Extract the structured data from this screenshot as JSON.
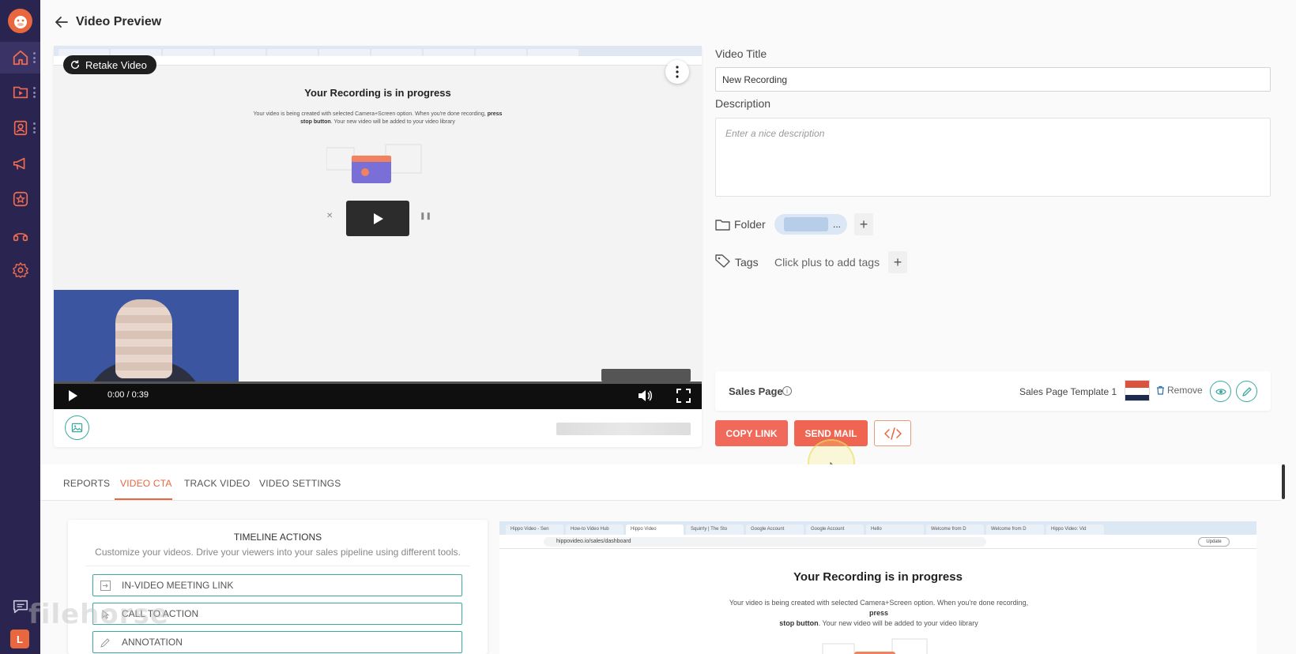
{
  "header": {
    "title": "Video Preview"
  },
  "sidebar": {
    "items": [
      {
        "icon": "home-icon",
        "active": true
      },
      {
        "icon": "video-library-icon"
      },
      {
        "icon": "contacts-icon"
      },
      {
        "icon": "campaign-megaphone-icon"
      },
      {
        "icon": "star-badge-icon"
      },
      {
        "icon": "integrations-icon"
      },
      {
        "icon": "gear-icon"
      }
    ],
    "user_initial": "L"
  },
  "player": {
    "retake_label": "Retake Video",
    "time": "0:00 / 0:39",
    "recording_title": "Your Recording is in progress",
    "recording_text_1": "Your video is being created with selected Camera+Screen option. When you're done recording,",
    "recording_text_bold_1": "press",
    "recording_text_bold_2": "stop button",
    "recording_text_2": ". Your new video will be added to your video library"
  },
  "form": {
    "video_title_label": "Video Title",
    "video_title_value": "New Recording",
    "description_label": "Description",
    "description_placeholder": "Enter a nice description",
    "folder_label": "Folder",
    "folder_ellipsis": "...",
    "tags_label": "Tags",
    "tags_placeholder": "Click plus to add tags",
    "plus": "+"
  },
  "sales_page": {
    "label": "Sales Page",
    "template": "Sales Page Template 1",
    "remove_label": "Remove"
  },
  "actions": {
    "copy_link": "COPY LINK",
    "send_mail": "SEND MAIL"
  },
  "tabs": [
    {
      "label": "REPORTS"
    },
    {
      "label": "VIDEO CTA",
      "active": true
    },
    {
      "label": "TRACK VIDEO"
    },
    {
      "label": "VIDEO SETTINGS"
    }
  ],
  "timeline": {
    "title": "TIMELINE ACTIONS",
    "subtitle": "Customize your videos. Drive your viewers into your sales pipeline using different tools.",
    "items": [
      {
        "label": "IN-VIDEO MEETING LINK",
        "icon": "meeting-link-icon"
      },
      {
        "label": "CALL TO ACTION",
        "icon": "cta-icon"
      },
      {
        "label": "ANNOTATION",
        "icon": "pencil-icon"
      }
    ]
  },
  "preview": {
    "tabs": [
      "Hippo Video - Sen",
      "How-to Video Hub",
      "Hippo Video",
      "Squirrly | The Sto",
      "Google Account",
      "Google Account",
      "Hello",
      "Welcome from D",
      "Welcome from D",
      "Hippo Video: Vid"
    ],
    "url": "hippovideo.io/sales/dashboard",
    "update_label": "Update",
    "title": "Your Recording is in progress",
    "text_1": "Your video is being created with selected Camera+Screen option. When you're done recording,",
    "text_bold_1": "press",
    "text_bold_2": "stop button",
    "text_2": ". Your new video will be added to your video library"
  },
  "watermark": "filehorse",
  "colors": {
    "sidebar": "#2a2550",
    "accent": "#e8673f",
    "teal": "#3aa9a0",
    "copy_button": "#f0695a",
    "send_button": "#ef6552"
  }
}
